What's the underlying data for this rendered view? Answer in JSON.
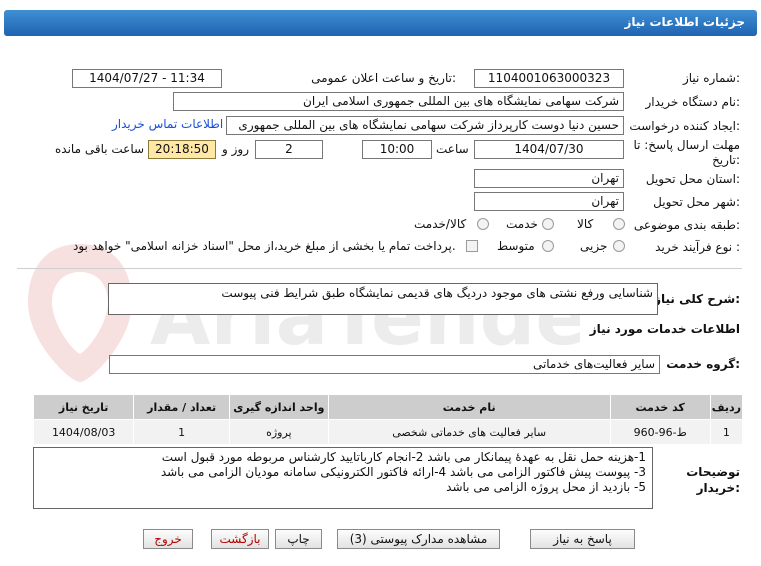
{
  "window": {
    "title": "جزئیات اطلاعات نیاز"
  },
  "form": {
    "need_number_label": "شماره نیاز:",
    "need_number": "1104001063000323",
    "announce_label": "تاریخ و ساعت اعلان عمومی:",
    "announce_value": "1404/07/27 - 11:34",
    "buyer_org_label": "نام دستگاه خریدار:",
    "buyer_org": "شرکت سهامی نمایشگاه های بین المللی جمهوری اسلامی ایران",
    "creator_label": "ایجاد کننده درخواست:",
    "creator": "حسین دنیا دوست کارپرداز شرکت سهامی نمایشگاه های بین المللی جمهوری",
    "contact_link": "اطلاعات تماس خریدار",
    "deadline_label_1": "مهلت ارسال پاسخ: تا",
    "deadline_label_2": "تاریخ:",
    "deadline_date": "1404/07/30",
    "time_label": "ساعت",
    "deadline_time": "10:00",
    "days_value": "2",
    "days_and_label": "روز و",
    "remaining_time": "20:18:50",
    "remaining_label": "ساعت باقی مانده",
    "province_label": "استان محل تحویل:",
    "province": "تهران",
    "city_label": "شهر محل تحویل:",
    "city": "تهران",
    "category_label": "طبقه بندی موضوعی:",
    "category_options": [
      "کالا",
      "خدمت",
      "کالا/خدمت"
    ],
    "purchase_type_label": "نوع فرآیند خرید :",
    "purchase_options": [
      "جزیی",
      "متوسط"
    ],
    "payment_note": "پرداخت تمام یا بخشی از مبلغ خرید،از محل \"اسناد خزانه اسلامی\" خواهد بود."
  },
  "description": {
    "label": "شرح کلی نیاز:",
    "text": "شناسایی ورفع نشتی های موجود دردیگ های قدیمی نمایشگاه طبق شرایط فنی پیوست"
  },
  "services": {
    "section_title": "اطلاعات خدمات مورد نیاز",
    "group_label": "گروه خدمت:",
    "group_value": "سایر فعالیت‌های خدماتی",
    "columns": [
      "ردیف",
      "کد خدمت",
      "نام خدمت",
      "واحد اندازه گیری",
      "تعداد / مقدار",
      "تاریخ نیاز"
    ],
    "rows": [
      [
        "1",
        "ط-96-960",
        "سایر فعالیت های خدماتی شخصی",
        "پروژه",
        "1",
        "1404/08/03"
      ]
    ]
  },
  "buyer_notes": {
    "label_1": "توضیحات",
    "label_2": "خریدار:",
    "lines": [
      "1-هزینه حمل نقل به عهدهٔ پیمانکار می باشد 2-انجام کارباتایید کارشناس مربوطه مورد قبول است",
      "3- پیوست پیش فاکتور الزامی می باشد 4-ارائه فاکتور الکترونیکی سامانه مودیان الزامی می باشد",
      "5- بازدید از محل پروژه الزامی می باشد"
    ]
  },
  "buttons": {
    "reply": "پاسخ به نیاز",
    "view_docs": "مشاهده مدارک پیوستی (3)",
    "print": "چاپ",
    "back": "بازگشت",
    "exit": "خروج"
  },
  "watermark": {
    "text": "AriaTender.net"
  }
}
